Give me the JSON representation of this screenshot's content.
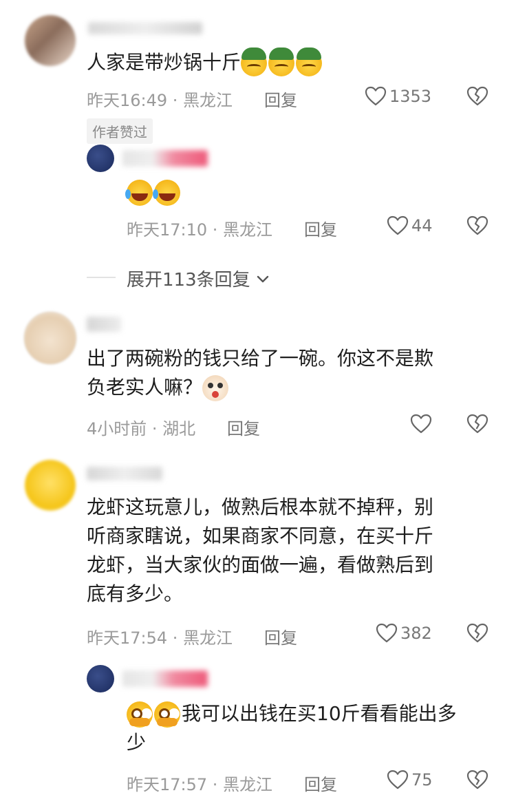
{
  "comments": [
    {
      "text": "人家是带炒锅十斤",
      "emojis": [
        "helmet-emoji",
        "helmet-emoji",
        "helmet-emoji"
      ],
      "time": "昨天16:49",
      "location": "黑龙江",
      "reply_label": "回复",
      "likes": "1353",
      "badge": "作者赞过",
      "replies": [
        {
          "text": "",
          "emojis": [
            "laugh-cry-emoji",
            "laugh-cry-emoji"
          ],
          "time": "昨天17:10",
          "location": "黑龙江",
          "reply_label": "回复",
          "likes": "44"
        }
      ],
      "expand_label": "展开113条回复"
    },
    {
      "text_line1": "出了两碗粉的钱只给了一碗。你这不是欺",
      "text_line2": "负老实人嘛？",
      "emojis": [
        "dog-emoji"
      ],
      "time": "4小时前",
      "location": "湖北",
      "reply_label": "回复",
      "likes": ""
    },
    {
      "text_lines": [
        "龙虾这玩意儿，做熟后根本就不掉秤，别",
        "听商家瞎说，如果商家不同意，在买十斤",
        "龙虾，当大家伙的面做一遍，看做熟后到",
        "底有多少。"
      ],
      "time": "昨天17:54",
      "location": "黑龙江",
      "reply_label": "回复",
      "likes": "382",
      "replies": [
        {
          "text_line1": "我可以出钱在买10斤看看能出多",
          "text_line2": "少",
          "emojis": [
            "pleading-emoji",
            "pleading-emoji"
          ],
          "time": "昨天17:57",
          "location": "黑龙江",
          "reply_label": "回复",
          "likes": "75"
        }
      ]
    }
  ],
  "separator": " · ",
  "icons": {
    "like": "heart-outline-icon",
    "dislike": "broken-heart-icon",
    "expand": "chevron-down-icon"
  },
  "colors": {
    "meta_text": "#9a9a9a",
    "body_text": "#1e1e1e",
    "badge_bg": "#f2f2f2"
  }
}
